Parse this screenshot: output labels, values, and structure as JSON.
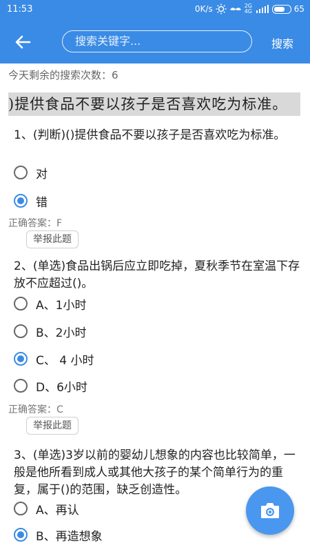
{
  "status_bar": {
    "time": "11:53",
    "network_speed": "0K/s",
    "signal_label": "2G 4G",
    "battery": "65"
  },
  "app_bar": {
    "search_placeholder": "搜索关键字...",
    "search_button": "搜索"
  },
  "remaining_searches": "今天剩余的搜索次数：6",
  "photo_banner": ")提供食品不要以孩子是否喜欢吃为标准。",
  "questions": [
    {
      "text": "1、(判断)()提供食品不要以孩子是否喜欢吃为标准。",
      "options": [
        {
          "label": "对",
          "selected": false
        },
        {
          "label": "错",
          "selected": true
        }
      ],
      "answer": "正确答案：F",
      "report": "举报此题"
    },
    {
      "text": "2、(单选)食品出锅后应立即吃掉，夏秋季节在室温下存放不应超过()。",
      "options": [
        {
          "label": "A、1小时",
          "selected": false
        },
        {
          "label": "B、2小时",
          "selected": false
        },
        {
          "label": "C、 4 小时",
          "selected": true
        },
        {
          "label": "D、6小时",
          "selected": false
        }
      ],
      "answer": "正确答案：C",
      "report": "举报此题"
    },
    {
      "text": "3、(单选)3岁以前的婴幼儿想象的内容也比较简单，一般是他所看到成人或其他大孩子的某个简单行为的重复，属于()的范围，缺乏创造性。",
      "options": [
        {
          "label": "A、再认",
          "selected": false
        },
        {
          "label": "B、再造想象",
          "selected": true
        }
      ]
    }
  ],
  "colors": {
    "primary": "#3a8be5",
    "fab": "#4a97ef"
  },
  "icons": {
    "back": "arrow-left",
    "fab": "camera"
  }
}
